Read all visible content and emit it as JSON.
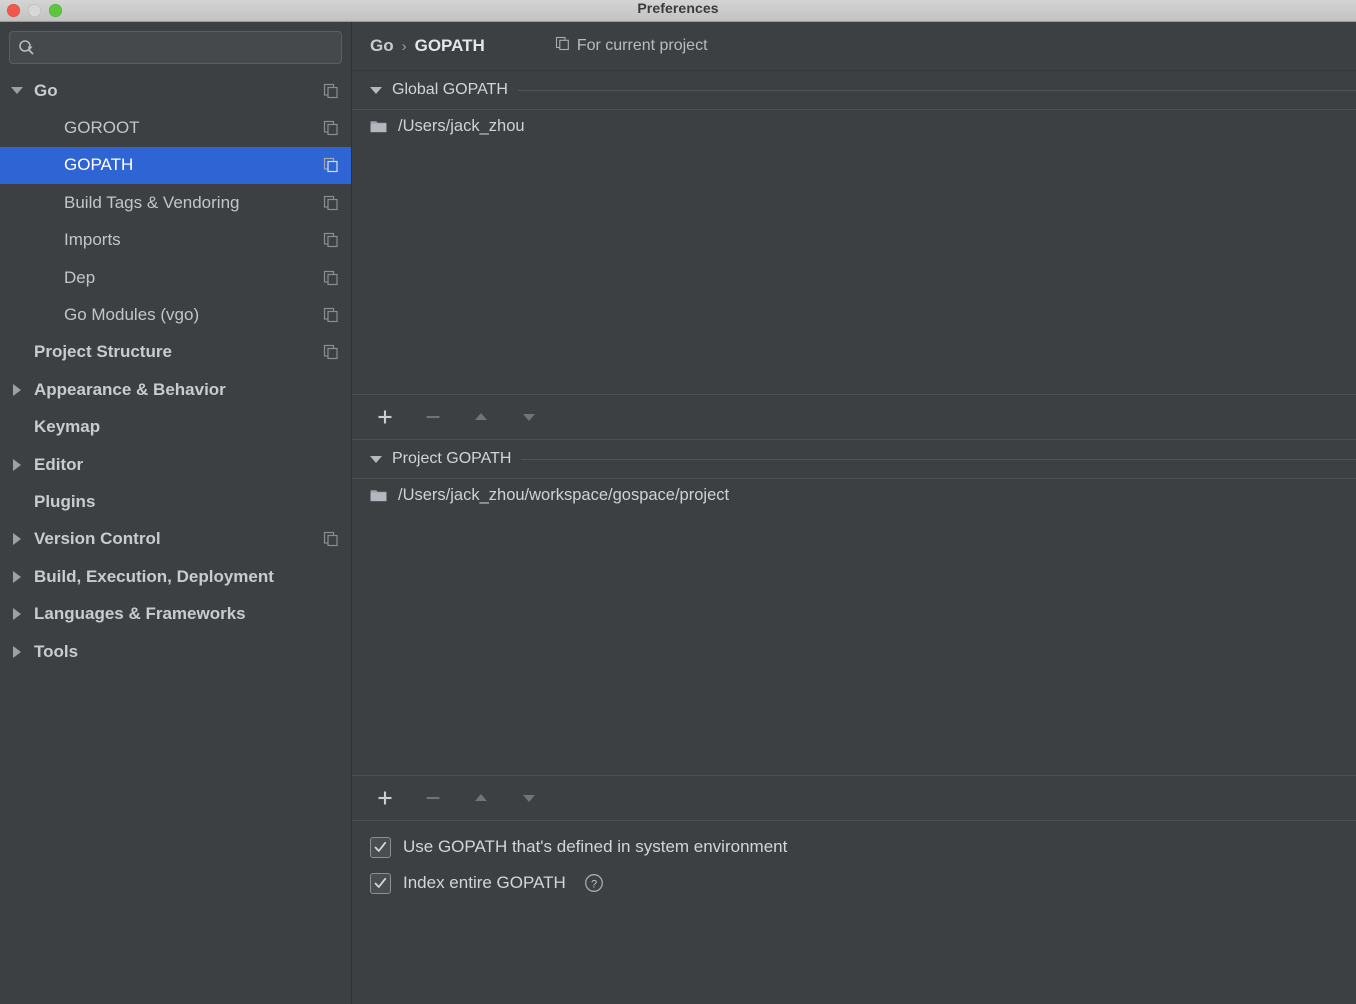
{
  "window": {
    "title": "Preferences",
    "traffic_lights": [
      "close-button",
      "minimize-button",
      "zoom-button"
    ],
    "colors": {
      "accent_selection": "#2e64d4",
      "panel_background": "#3c4043",
      "titlebar_background": "#c9c9c9",
      "text_primary": "#c8cace",
      "text_selected": "#ffffff"
    }
  },
  "search": {
    "value": "",
    "placeholder": "",
    "icon": "search-icon"
  },
  "sidebar": {
    "items": [
      {
        "label": "Go",
        "level": 0,
        "bold": true,
        "expander": "down",
        "config_icon": true,
        "selected": false
      },
      {
        "label": "GOROOT",
        "level": 1,
        "bold": false,
        "expander": "none",
        "config_icon": true,
        "selected": false
      },
      {
        "label": "GOPATH",
        "level": 1,
        "bold": false,
        "expander": "none",
        "config_icon": true,
        "selected": true
      },
      {
        "label": "Build Tags & Vendoring",
        "level": 1,
        "bold": false,
        "expander": "none",
        "config_icon": true,
        "selected": false
      },
      {
        "label": "Imports",
        "level": 1,
        "bold": false,
        "expander": "none",
        "config_icon": true,
        "selected": false
      },
      {
        "label": "Dep",
        "level": 1,
        "bold": false,
        "expander": "none",
        "config_icon": true,
        "selected": false
      },
      {
        "label": "Go Modules (vgo)",
        "level": 1,
        "bold": false,
        "expander": "none",
        "config_icon": true,
        "selected": false
      },
      {
        "label": "Project Structure",
        "level": 0,
        "bold": true,
        "expander": "none",
        "config_icon": true,
        "selected": false
      },
      {
        "label": "Appearance & Behavior",
        "level": 0,
        "bold": true,
        "expander": "right",
        "config_icon": false,
        "selected": false
      },
      {
        "label": "Keymap",
        "level": 0,
        "bold": true,
        "expander": "none",
        "config_icon": false,
        "selected": false
      },
      {
        "label": "Editor",
        "level": 0,
        "bold": true,
        "expander": "right",
        "config_icon": false,
        "selected": false
      },
      {
        "label": "Plugins",
        "level": 0,
        "bold": true,
        "expander": "none",
        "config_icon": false,
        "selected": false
      },
      {
        "label": "Version Control",
        "level": 0,
        "bold": true,
        "expander": "right",
        "config_icon": true,
        "selected": false
      },
      {
        "label": "Build, Execution, Deployment",
        "level": 0,
        "bold": true,
        "expander": "right",
        "config_icon": false,
        "selected": false
      },
      {
        "label": "Languages & Frameworks",
        "level": 0,
        "bold": true,
        "expander": "right",
        "config_icon": false,
        "selected": false
      },
      {
        "label": "Tools",
        "level": 0,
        "bold": true,
        "expander": "right",
        "config_icon": false,
        "selected": false
      }
    ]
  },
  "breadcrumb": {
    "root": "Go",
    "separator": "›",
    "current": "GOPATH",
    "scope_label": "For current project",
    "scope_icon": "copy-config-icon"
  },
  "sections": {
    "global": {
      "title": "Global GOPATH",
      "expanded": true,
      "paths": [
        {
          "path": "/Users/jack_zhou",
          "icon": "folder-icon"
        }
      ],
      "toolbar": {
        "add_label": "+",
        "remove_label": "−",
        "move_up_label": "Move Up",
        "move_down_label": "Move Down",
        "add_enabled": true,
        "remove_enabled": false,
        "move_up_enabled": false,
        "move_down_enabled": false
      }
    },
    "project": {
      "title": "Project GOPATH",
      "expanded": true,
      "paths": [
        {
          "path": "/Users/jack_zhou/workspace/gospace/project",
          "icon": "folder-icon"
        }
      ],
      "toolbar": {
        "add_label": "+",
        "remove_label": "−",
        "move_up_label": "Move Up",
        "move_down_label": "Move Down",
        "add_enabled": true,
        "remove_enabled": false,
        "move_up_enabled": false,
        "move_down_enabled": false
      }
    }
  },
  "options": [
    {
      "label": "Use GOPATH that's defined in system environment",
      "checked": true,
      "help": false
    },
    {
      "label": "Index entire GOPATH",
      "checked": true,
      "help": true,
      "help_icon": "help-circle-icon"
    }
  ]
}
